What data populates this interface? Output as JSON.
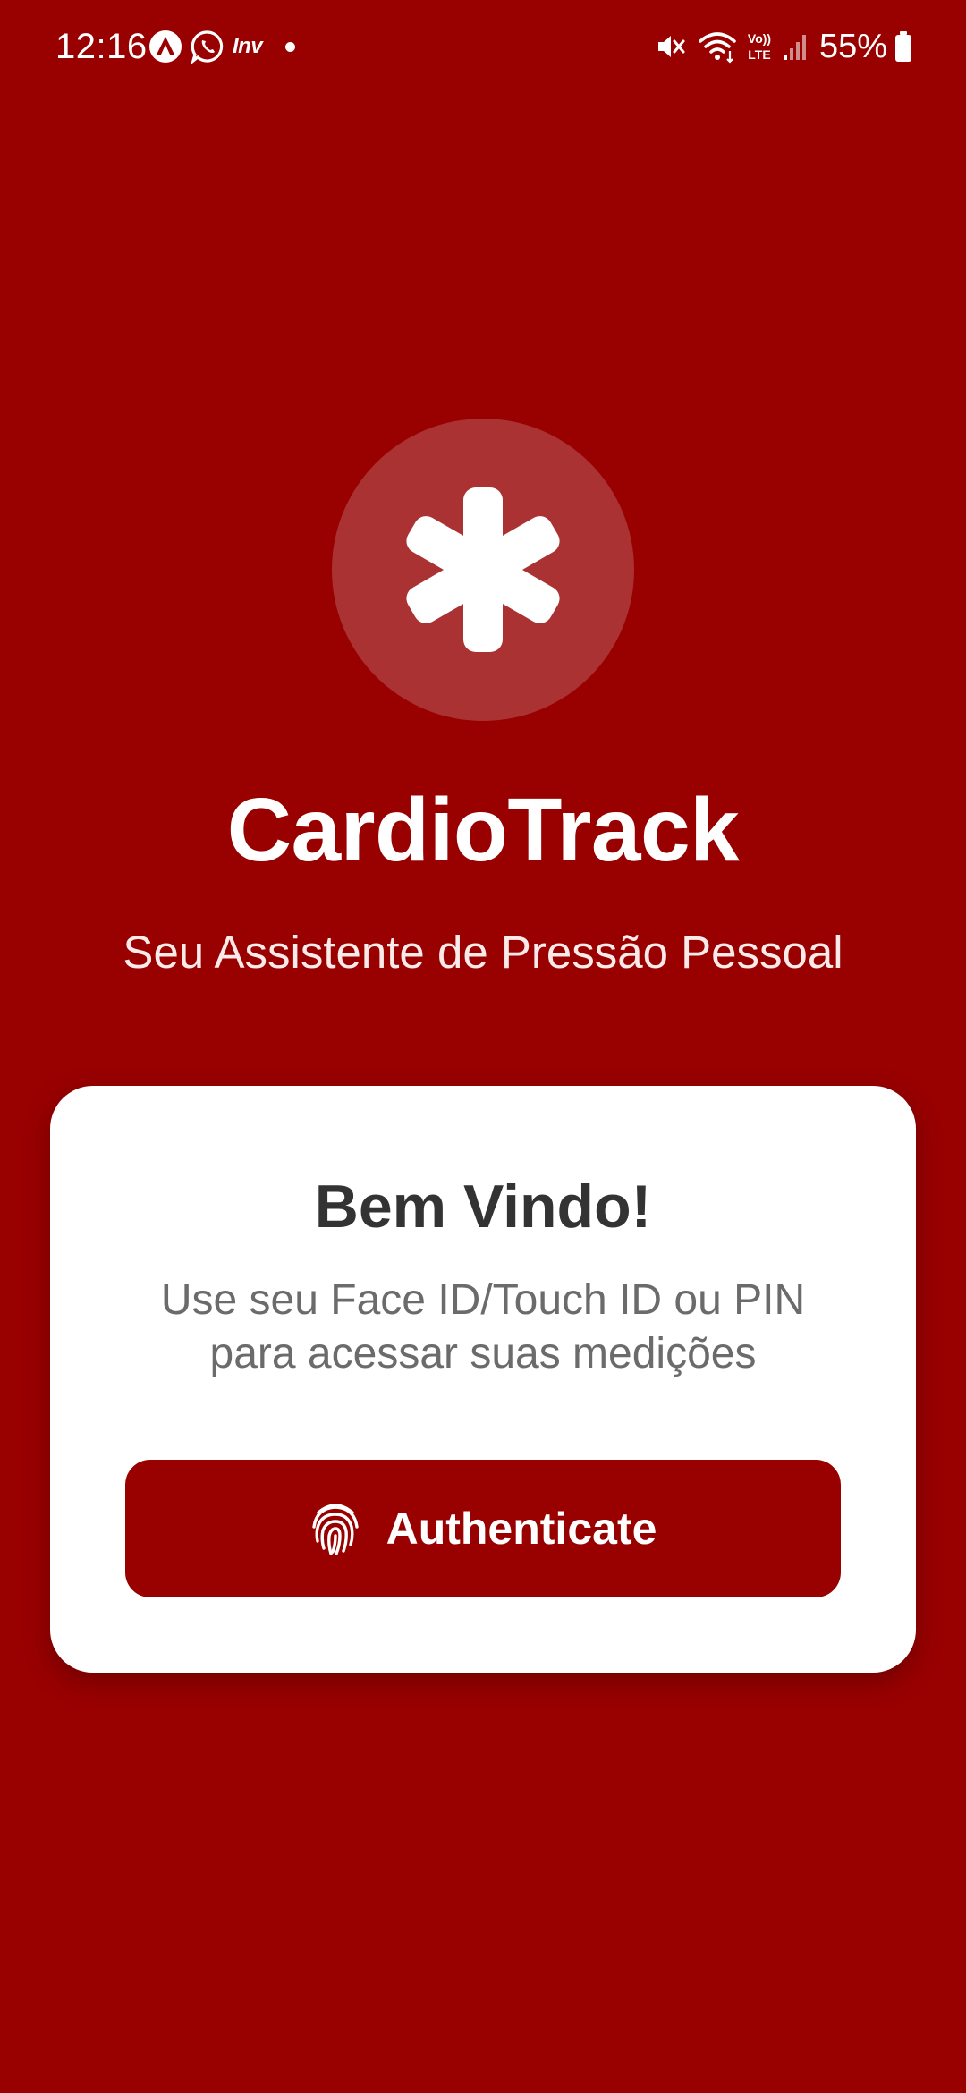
{
  "status_bar": {
    "time": "12:16",
    "notification_icons": [
      "app-a-icon",
      "whatsapp-icon",
      "inv-icon",
      "notification-dot"
    ],
    "inv_label": "Inv",
    "system_icons": [
      "mute-icon",
      "wifi-icon",
      "volte-icon",
      "signal-icon",
      "battery-icon"
    ],
    "battery_percent": "55%"
  },
  "app": {
    "logo_icon": "medical-asterisk-icon",
    "title": "CardioTrack",
    "subtitle": "Seu Assistente de Pressão Pessoal"
  },
  "card": {
    "title": "Bem Vindo!",
    "description_line1": "Use seu Face ID/Touch ID ou PIN",
    "description_line2": "para acessar suas medições",
    "button_icon": "fingerprint-icon",
    "button_label": "Authenticate"
  },
  "colors": {
    "background": "#990000",
    "logo_circle": "#ab3232",
    "card": "#ffffff",
    "button": "#990000",
    "card_title": "#333333",
    "card_text": "#6b6b6b"
  }
}
